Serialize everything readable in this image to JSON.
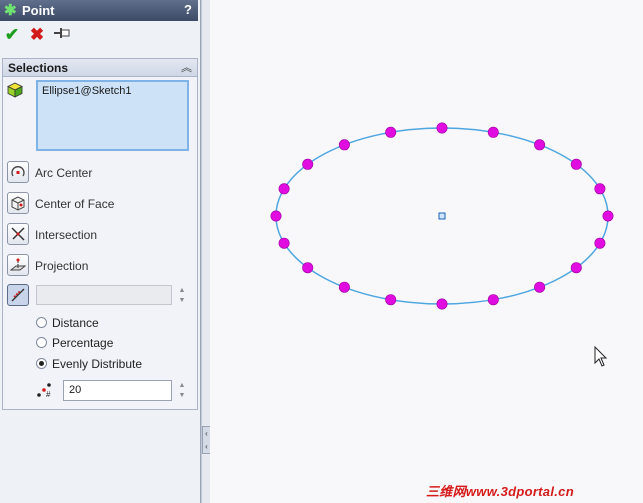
{
  "panel": {
    "title": "Point",
    "help": "?",
    "selections_header": "Selections",
    "selection_item": "Ellipse1@Sketch1",
    "options": [
      {
        "label": "Arc Center",
        "icon": "arc-center-icon"
      },
      {
        "label": "Center of Face",
        "icon": "center-of-face-icon"
      },
      {
        "label": "Intersection",
        "icon": "intersection-icon"
      },
      {
        "label": "Projection",
        "icon": "projection-icon"
      }
    ],
    "distance_value": "",
    "radios": [
      {
        "label": "Distance",
        "selected": false
      },
      {
        "label": "Percentage",
        "selected": false
      },
      {
        "label": "Evenly Distribute",
        "selected": true
      }
    ],
    "count": "20"
  },
  "graphics": {
    "points_count": 20,
    "ellipse_color": "#4da6e0",
    "point_color": "#e00ce0"
  },
  "watermark": "三维网www.3dportal.cn"
}
